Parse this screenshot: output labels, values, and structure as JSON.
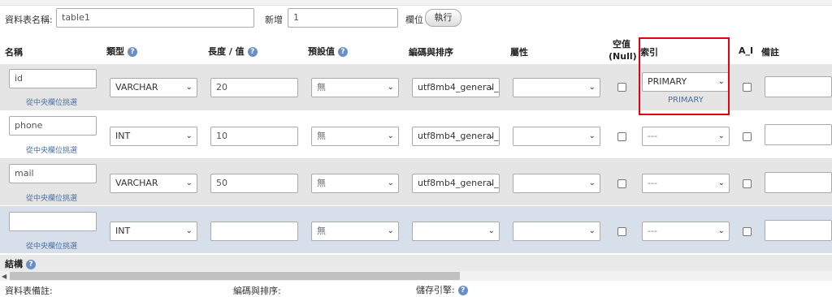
{
  "table_name": {
    "label": "資料表名稱:",
    "value": "table1"
  },
  "add": {
    "label": "新增",
    "value": "1",
    "suffix": "欄位",
    "button": "執行"
  },
  "headers": {
    "name": "名稱",
    "type": "類型",
    "length": "長度 / 值",
    "default": "預設值",
    "collation": "編碼與排序",
    "attributes": "屬性",
    "null_line1": "空值",
    "null_line2": "(Null)",
    "index": "索引",
    "ai": "A_I",
    "comments": "備註"
  },
  "pick_text": "從中央欄位挑選",
  "rows": [
    {
      "name": "id",
      "type": "VARCHAR",
      "length": "20",
      "default": "無",
      "collation": "utf8mb4_general_",
      "attributes": "",
      "index": "PRIMARY",
      "index_note": "PRIMARY"
    },
    {
      "name": "phone",
      "type": "INT",
      "length": "10",
      "default": "無",
      "collation": "utf8mb4_general_",
      "attributes": "",
      "index": "---",
      "index_note": ""
    },
    {
      "name": "mail",
      "type": "VARCHAR",
      "length": "50",
      "default": "無",
      "collation": "utf8mb4_general_",
      "attributes": "",
      "index": "---",
      "index_note": ""
    },
    {
      "name": "",
      "type": "INT",
      "length": "",
      "default": "無",
      "collation": "",
      "attributes": "",
      "index": "---",
      "index_note": ""
    }
  ],
  "structure": {
    "label": "結構"
  },
  "bottom": {
    "comment_label": "資料表備註:",
    "collation_label": "編碼與排序:",
    "engine_label": "儲存引擎:"
  },
  "icons": {
    "help": "help-icon",
    "dropdown": "chevron-down-icon"
  },
  "colors": {
    "highlight_box": "#e8000d",
    "help_icon": "#6a8fc7",
    "row_gray": "#e5e5e5",
    "row_blue": "#d7dfea"
  }
}
